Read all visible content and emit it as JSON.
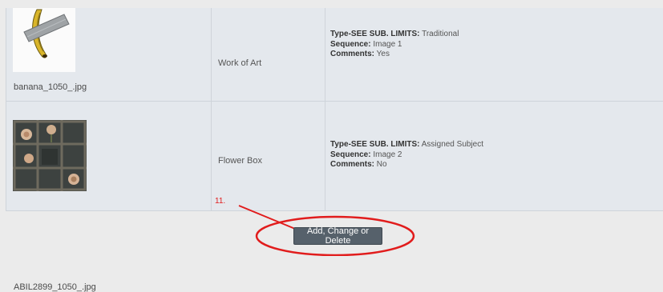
{
  "rows": [
    {
      "filename": "banana_1050_.jpg",
      "title": "Work of Art",
      "type_label": "Type-SEE SUB. LIMITS:",
      "type_value": "Traditional",
      "sequence_label": "Sequence:",
      "sequence_value": "Image 1",
      "comments_label": "Comments:",
      "comments_value": "Yes",
      "thumb_icon": "banana-taped-image"
    },
    {
      "filename": "ABIL2899_1050_.jpg",
      "title": "Flower Box",
      "type_label": "Type-SEE SUB. LIMITS:",
      "type_value": "Assigned Subject",
      "sequence_label": "Sequence:",
      "sequence_value": "Image 2",
      "comments_label": "Comments:",
      "comments_value": "No",
      "thumb_icon": "flower-box-image"
    }
  ],
  "annotation": {
    "step_label": "11.",
    "color": "#e11c1c"
  },
  "actions": {
    "add_change_delete": "Add, Change or Delete"
  }
}
